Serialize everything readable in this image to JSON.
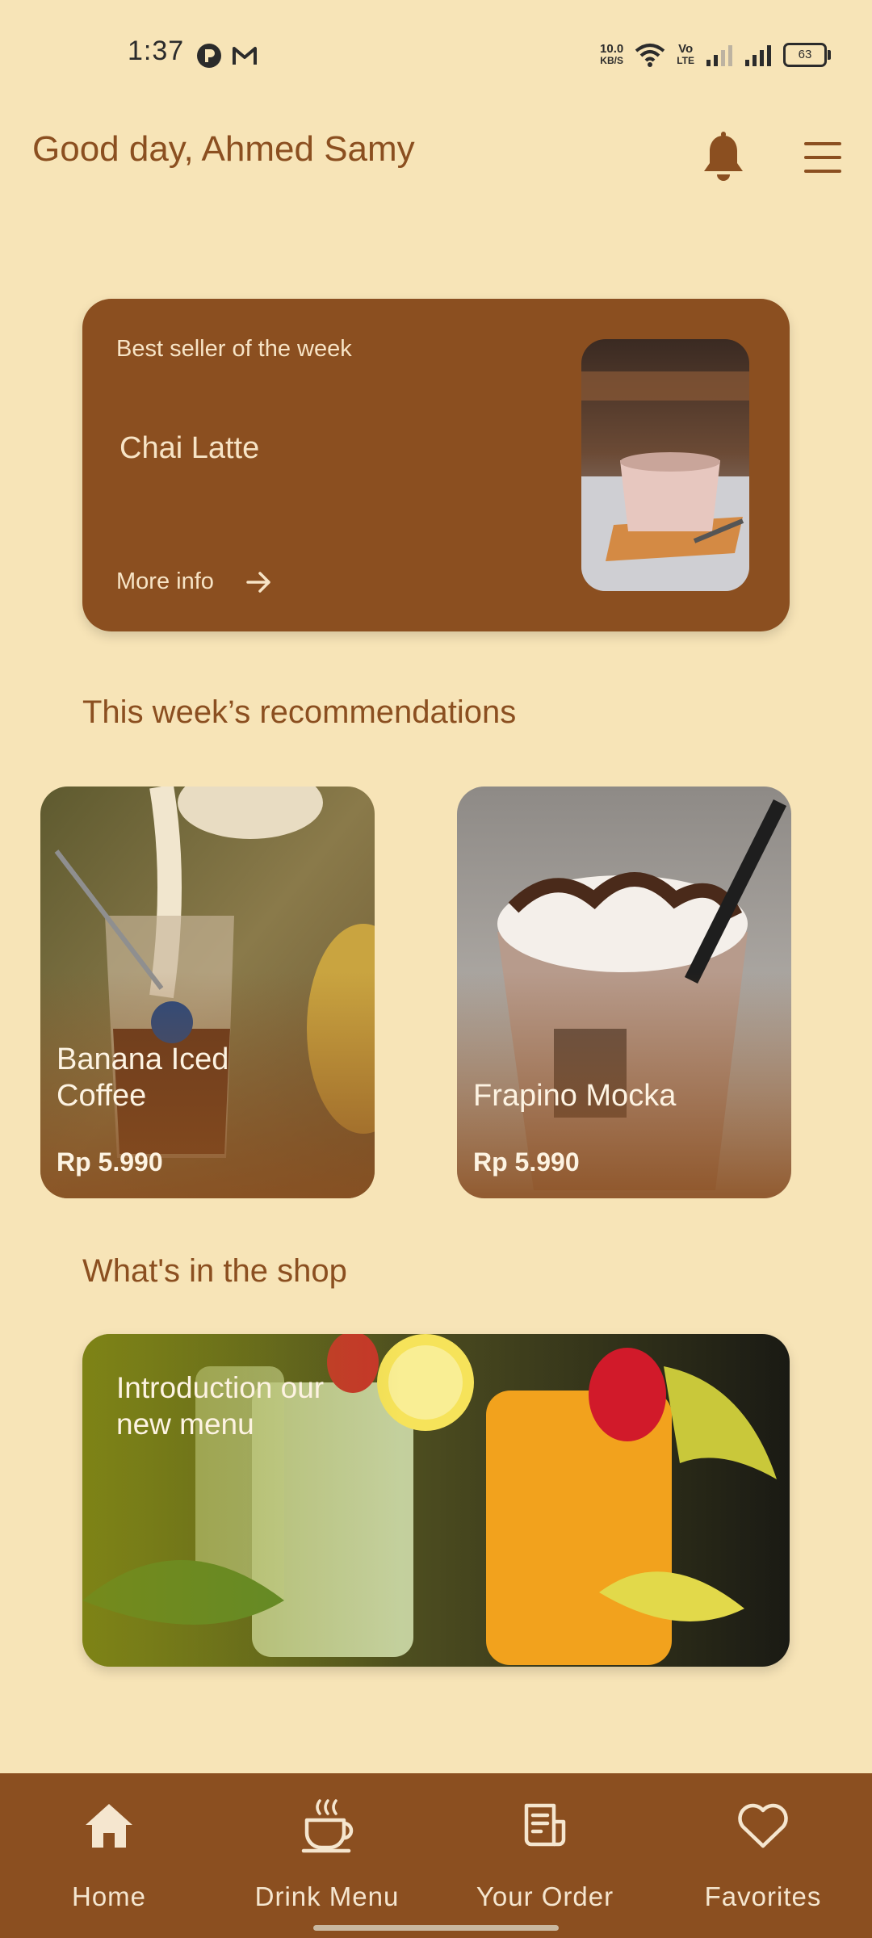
{
  "status_bar": {
    "time": "1:37",
    "net_speed_value": "10.0",
    "net_speed_unit": "KB/S",
    "volte_top": "Vo",
    "volte_bottom": "LTE",
    "battery": "63",
    "icons": [
      "app-notification-icon",
      "gmail-icon",
      "wifi-icon",
      "signal-icon",
      "battery-icon"
    ]
  },
  "header": {
    "greeting": "Good day, Ahmed Samy",
    "icons": [
      "bell-icon",
      "hamburger-menu-icon"
    ]
  },
  "best_seller": {
    "subtitle": "Best seller of the week",
    "name": "Chai Latte",
    "more_info": "More info"
  },
  "recommendations": {
    "title": "This week’s recommendations",
    "items": [
      {
        "name": "Banana Iced Coffee",
        "line1": "Banana Iced",
        "line2": "Coffee",
        "price": "Rp 5.990"
      },
      {
        "name": "Frapino Mocka",
        "price": "Rp 5.990"
      }
    ]
  },
  "shop": {
    "title": "What's in the shop",
    "banner_line1": "Introduction our",
    "banner_line2": "new menu"
  },
  "nav": {
    "items": [
      {
        "label": "Home",
        "icon": "home-icon"
      },
      {
        "label": "Drink Menu",
        "icon": "coffee-cup-icon"
      },
      {
        "label": "Your Order",
        "icon": "receipt-icon"
      },
      {
        "label": "Favorites",
        "icon": "heart-icon"
      }
    ]
  },
  "colors": {
    "background": "#F7E4B7",
    "brand_brown": "#8B4F20",
    "light_text": "#F7E4C6"
  }
}
